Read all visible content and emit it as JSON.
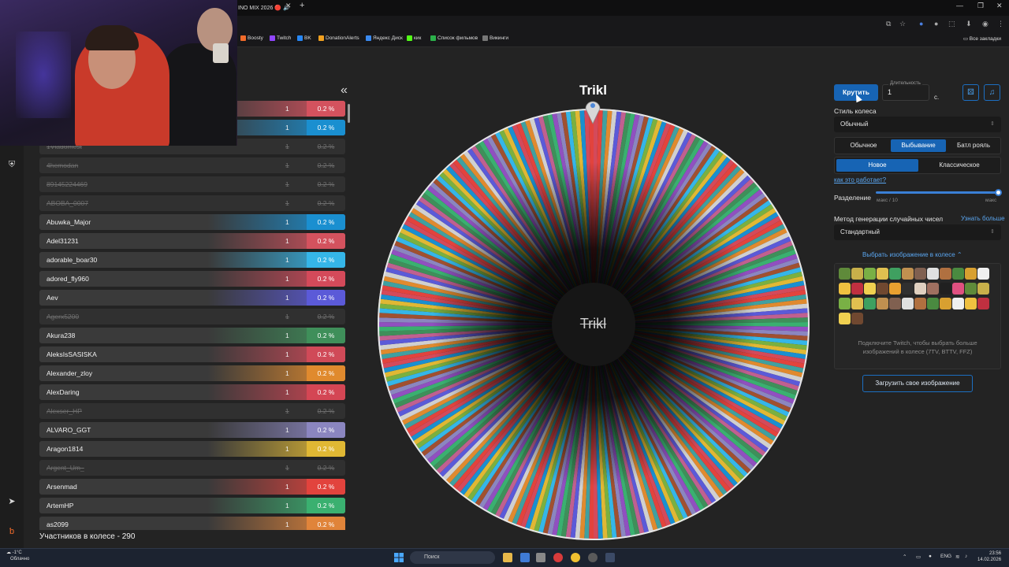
{
  "browser": {
    "tab_title": "INO MIX 2026",
    "bookmarks": [
      "Boosty",
      "Twitch",
      "BK",
      "DonationAlerts",
      "Яндекс Диск",
      "кик",
      "Список фильмов",
      "Викинги"
    ],
    "all_bookmarks": "Все закладки"
  },
  "list": {
    "rows": [
      {
        "name": "",
        "count": "1",
        "pct": "0.2 %",
        "active": true,
        "color": "#d4525e"
      },
      {
        "name": "",
        "count": "1",
        "pct": "0.2 %",
        "active": true,
        "color": "#1a8fd0"
      },
      {
        "name": "1Vladomest",
        "count": "1",
        "pct": "0.2 %",
        "active": false,
        "color": "#333"
      },
      {
        "name": "4hemodan",
        "count": "1",
        "pct": "0.2 %",
        "active": false,
        "color": "#333"
      },
      {
        "name": "89145224469",
        "count": "1",
        "pct": "0.2 %",
        "active": false,
        "color": "#333"
      },
      {
        "name": "ABOBA_0007",
        "count": "1",
        "pct": "0.2 %",
        "active": false,
        "color": "#333"
      },
      {
        "name": "Abuwka_Major",
        "count": "1",
        "pct": "0.2 %",
        "active": true,
        "color": "#1a8fd0"
      },
      {
        "name": "Adel31231",
        "count": "1",
        "pct": "0.2 %",
        "active": true,
        "color": "#d4525e"
      },
      {
        "name": "adorable_boar30",
        "count": "1",
        "pct": "0.2 %",
        "active": true,
        "color": "#35b6e8"
      },
      {
        "name": "adored_fly960",
        "count": "1",
        "pct": "0.2 %",
        "active": true,
        "color": "#d44a5a"
      },
      {
        "name": "Aev",
        "count": "1",
        "pct": "0.2 %",
        "active": true,
        "color": "#5b5ad8"
      },
      {
        "name": "Agerx5200",
        "count": "1",
        "pct": "0.2 %",
        "active": false,
        "color": "#333"
      },
      {
        "name": "Akura238",
        "count": "1",
        "pct": "0.2 %",
        "active": true,
        "color": "#3f8f5a"
      },
      {
        "name": "AleksIsSASISKA",
        "count": "1",
        "pct": "0.2 %",
        "active": true,
        "color": "#d04a58"
      },
      {
        "name": "Alexander_zloy",
        "count": "1",
        "pct": "0.2 %",
        "active": true,
        "color": "#e08a2e"
      },
      {
        "name": "AlexDaring",
        "count": "1",
        "pct": "0.2 %",
        "active": true,
        "color": "#d44654"
      },
      {
        "name": "Alexser_HP",
        "count": "1",
        "pct": "0.2 %",
        "active": false,
        "color": "#333"
      },
      {
        "name": "ALVARO_GGT",
        "count": "1",
        "pct": "0.2 %",
        "active": true,
        "color": "#8b86c0"
      },
      {
        "name": "Aragon1814",
        "count": "1",
        "pct": "0.2 %",
        "active": true,
        "color": "#e0b834"
      },
      {
        "name": "Argent_Um_",
        "count": "1",
        "pct": "0.2 %",
        "active": false,
        "color": "#333"
      },
      {
        "name": "Arsenmad",
        "count": "1",
        "pct": "0.2 %",
        "active": true,
        "color": "#e2433d"
      },
      {
        "name": "ArtemHP",
        "count": "1",
        "pct": "0.2 %",
        "active": true,
        "color": "#3ab070"
      },
      {
        "name": "as2099",
        "count": "1",
        "pct": "0.2 %",
        "active": true,
        "color": "#e0843a"
      }
    ],
    "footer": "Участников в колесе - 290"
  },
  "wheel": {
    "title": "Trikl",
    "center_text": "Trikl",
    "segments": 290
  },
  "panel": {
    "spin_label": "Крутить",
    "duration_label": "Длительность",
    "duration_value": "1",
    "duration_unit": "с.",
    "style_label": "Стиль колеса",
    "style_value": "Обычный",
    "modes": [
      "Обычное",
      "Выбывание",
      "Батл рояль"
    ],
    "submodes": [
      "Новое",
      "Классическое"
    ],
    "how_link": "как это работает?",
    "split_label": "Разделение",
    "split_min": "макс / 10",
    "split_max": "макс",
    "rng_label": "Метод генерации случайных чисел",
    "rng_more": "Узнать больше",
    "rng_value": "Стандартный",
    "image_toggle": "Выбрать изображение в колесе",
    "image_hint": "Подключите Twitch, чтобы выбрать больше изображений в колесе (7TV, BTTV, FFZ)",
    "upload_label": "Загрузить свое изображение"
  },
  "taskbar": {
    "weather_temp": "-1°C",
    "weather_desc": "Облачно",
    "search": "Поиск",
    "lang": "ENG",
    "time": "23:56",
    "date": "14.02.2026"
  }
}
